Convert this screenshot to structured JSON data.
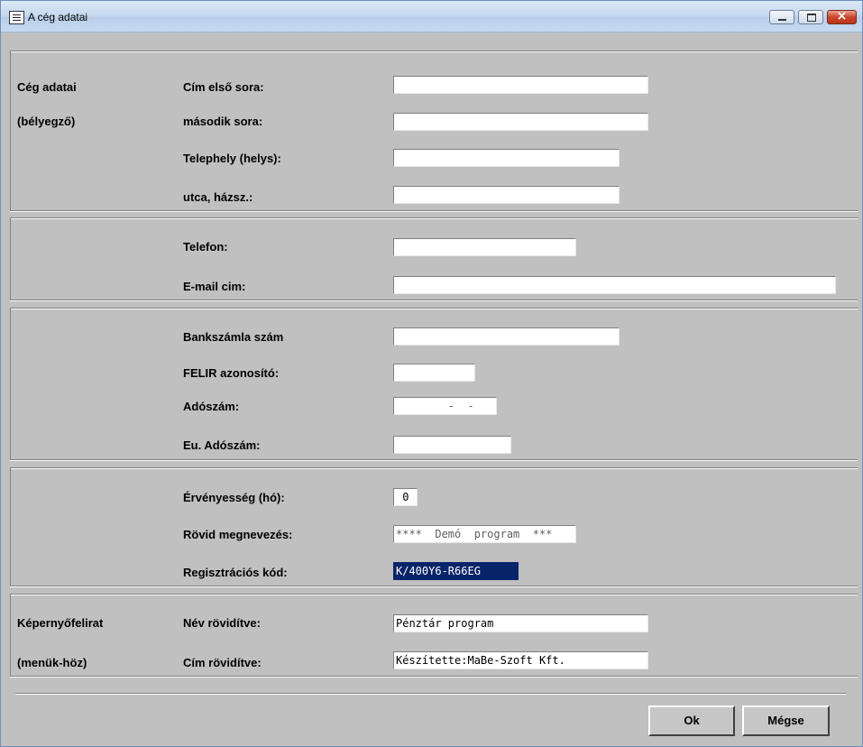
{
  "window": {
    "title": "A cég adatai"
  },
  "sections": {
    "company": {
      "heading": "Cég adatai",
      "subheading": "(bélyegző)"
    },
    "screen": {
      "heading": "Képernyőfelirat",
      "subheading": "(menük-höz)"
    }
  },
  "fields": {
    "address1": {
      "label": "Cím első sora:",
      "value": ""
    },
    "address2": {
      "label": "második sora:",
      "value": ""
    },
    "site": {
      "label": "Telephely (helys):",
      "value": ""
    },
    "street": {
      "label": "utca, házsz.:",
      "value": ""
    },
    "phone": {
      "label": "Telefon:",
      "value": ""
    },
    "email": {
      "label": "E-mail cim:",
      "value": ""
    },
    "bank": {
      "label": "Bankszámla szám",
      "value": ""
    },
    "felir": {
      "label": "FELIR azonosító:",
      "value": ""
    },
    "tax": {
      "label": "Adószám:",
      "value": "        -  -"
    },
    "eu_tax": {
      "label": "Eu. Adószám:",
      "value": ""
    },
    "validity": {
      "label": "Érvényesség (hó):",
      "value": " 0"
    },
    "short_name": {
      "label": "Rövid megnevezés:",
      "value": "****  Demó  program  ***"
    },
    "reg_code": {
      "label": "Regisztrációs kód:",
      "value": "K/400Y6-R66EG"
    },
    "name_short": {
      "label": "Név rövidítve:",
      "value": "Pénztár program"
    },
    "address_short": {
      "label": "Cím rövidítve:",
      "value": "Készítette:MaBe-Szoft Kft."
    }
  },
  "buttons": {
    "ok": "Ok",
    "cancel": "Mégse"
  },
  "icons": {
    "app": "window-app-icon",
    "minimize": "minimize-icon",
    "maximize": "maximize-icon",
    "close": "close-icon"
  },
  "colors": {
    "background": "#c0c0c0",
    "selection": "#0a246a",
    "close_button": "#c8462a"
  }
}
